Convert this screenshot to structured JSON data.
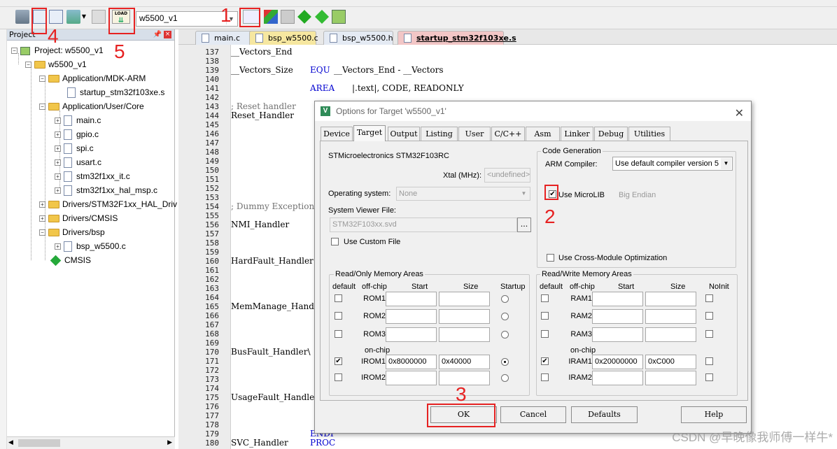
{
  "toolbar": {
    "target_name": "w5500_v1"
  },
  "annotations": [
    "1",
    "2",
    "3",
    "4",
    "5"
  ],
  "project_panel": {
    "title": "Project",
    "tree": [
      {
        "label": "Project: w5500_v1",
        "kind": "root"
      },
      {
        "label": "w5500_v1",
        "kind": "target"
      },
      {
        "label": "Application/MDK-ARM",
        "kind": "group"
      },
      {
        "label": "startup_stm32f103xe.s",
        "kind": "file"
      },
      {
        "label": "Application/User/Core",
        "kind": "group"
      },
      {
        "label": "main.c",
        "kind": "file"
      },
      {
        "label": "gpio.c",
        "kind": "file"
      },
      {
        "label": "spi.c",
        "kind": "file"
      },
      {
        "label": "usart.c",
        "kind": "file"
      },
      {
        "label": "stm32f1xx_it.c",
        "kind": "file"
      },
      {
        "label": "stm32f1xx_hal_msp.c",
        "kind": "file"
      },
      {
        "label": "Drivers/STM32F1xx_HAL_Driv",
        "kind": "group"
      },
      {
        "label": "Drivers/CMSIS",
        "kind": "group"
      },
      {
        "label": "Drivers/bsp",
        "kind": "group"
      },
      {
        "label": "bsp_w5500.c",
        "kind": "file"
      },
      {
        "label": "CMSIS",
        "kind": "component"
      }
    ]
  },
  "editor_tabs": [
    "main.c",
    "bsp_w5500.c",
    "bsp_w5500.h",
    "startup_stm32f103xe.s"
  ],
  "editor": {
    "line_numbers": [
      "137",
      "138",
      "139",
      "140",
      "141",
      "142",
      "143",
      "144",
      "145",
      "146",
      "147",
      "148",
      "149",
      "150",
      "151",
      "152",
      "153",
      "154",
      "155",
      "156",
      "157",
      "158",
      "159",
      "160",
      "161",
      "162",
      "163",
      "164",
      "165",
      "166",
      "167",
      "168",
      "169",
      "170",
      "171",
      "172",
      "173",
      "174",
      "175",
      "176",
      "177",
      "178",
      "179",
      "180"
    ],
    "vectors_end": "__Vectors_End",
    "vectors_size": "__Vectors_Size",
    "equ": "EQU",
    "equ_expr": "__Vectors_End - __Vectors",
    "area": "AREA",
    "area_args": "|.text|, CODE, READONLY",
    "reset_comment": "; Reset handler",
    "reset_handler": "Reset_Handler",
    "dummy_comment": "; Dummy Exception",
    "nmi": "NMI_Handler",
    "hardfault": "HardFault_Handler",
    "memmanage": "MemManage_Handler",
    "busfault": "BusFault_Handler\\",
    "usagefault": "UsageFault_Handle",
    "svc": "SVC_Handler",
    "endp": "ENDP",
    "proc": "PROC"
  },
  "dialog": {
    "title": "Options for Target 'w5500_v1'",
    "tabs": [
      "Device",
      "Target",
      "Output",
      "Listing",
      "User",
      "C/C++",
      "Asm",
      "Linker",
      "Debug",
      "Utilities"
    ],
    "active_tab": "Target",
    "device_name": "STMicroelectronics STM32F103RC",
    "xtal_label": "Xtal (MHz):",
    "xtal_value": "<undefined>",
    "os_label": "Operating system:",
    "os_value": "None",
    "svd_label": "System Viewer File:",
    "svd_value": "STM32F103xx.svd",
    "svd_browse": "...",
    "custom_file_label": "Use Custom File",
    "codegen_title": "Code Generation",
    "arm_compiler_label": "ARM Compiler:",
    "arm_compiler_value": "Use default compiler version 5",
    "microlib_label": "Use MicroLIB",
    "microlib_checked": true,
    "big_endian_label": "Big Endian",
    "cross_module_label": "Use Cross-Module Optimization",
    "ro_title": "Read/Only Memory Areas",
    "rw_title": "Read/Write Memory Areas",
    "col_default": "default",
    "col_offchip": "off-chip",
    "col_start": "Start",
    "col_size": "Size",
    "col_startup": "Startup",
    "col_noinit": "NoInit",
    "onchip_label": "on-chip",
    "ro_rows": [
      {
        "name": "ROM1:",
        "start": "",
        "size": "",
        "default": false,
        "startup": false
      },
      {
        "name": "ROM2:",
        "start": "",
        "size": "",
        "default": false,
        "startup": false
      },
      {
        "name": "ROM3:",
        "start": "",
        "size": "",
        "default": false,
        "startup": false
      },
      {
        "name": "IROM1:",
        "start": "0x8000000",
        "size": "0x40000",
        "default": true,
        "startup": true
      },
      {
        "name": "IROM2:",
        "start": "",
        "size": "",
        "default": false,
        "startup": false
      }
    ],
    "rw_rows": [
      {
        "name": "RAM1:",
        "start": "",
        "size": "",
        "default": false,
        "noinit": false
      },
      {
        "name": "RAM2:",
        "start": "",
        "size": "",
        "default": false,
        "noinit": false
      },
      {
        "name": "RAM3:",
        "start": "",
        "size": "",
        "default": false,
        "noinit": false
      },
      {
        "name": "IRAM1:",
        "start": "0x20000000",
        "size": "0xC000",
        "default": true,
        "noinit": false
      },
      {
        "name": "IRAM2:",
        "start": "",
        "size": "",
        "default": false,
        "noinit": false
      }
    ],
    "buttons": {
      "ok": "OK",
      "cancel": "Cancel",
      "defaults": "Defaults",
      "help": "Help"
    }
  },
  "watermark": "CSDN @早晚像我师傅一样牛*",
  "colors": {
    "annotation": "#e62222",
    "keyword": "#0000d0",
    "comment": "#707070"
  }
}
